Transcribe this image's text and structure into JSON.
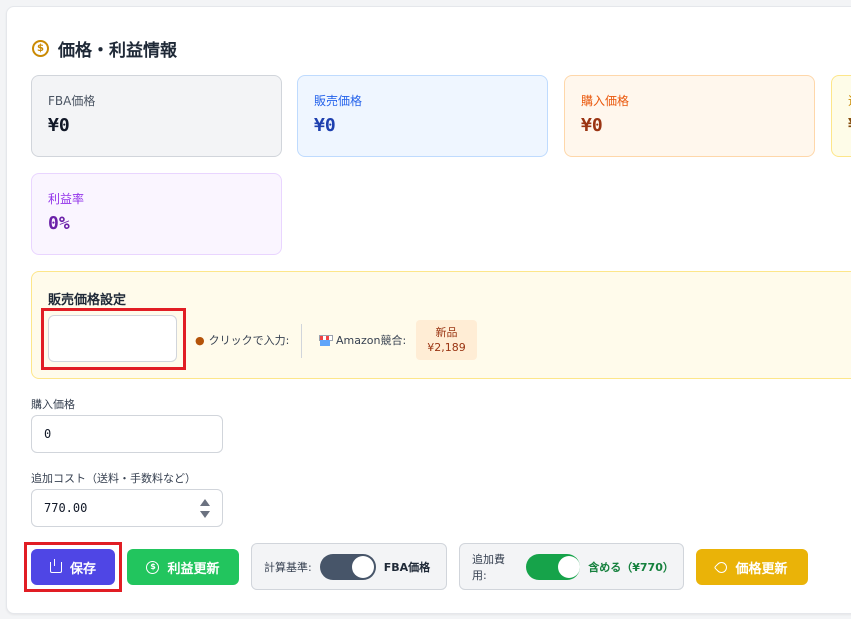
{
  "header": {
    "title": "価格・利益情報",
    "icon": "dollar-circle-icon"
  },
  "cards": {
    "fba": {
      "label": "FBA価格",
      "value": "¥0"
    },
    "sell": {
      "label": "販売価格",
      "value": "¥0"
    },
    "buy": {
      "label": "購入価格",
      "value": "¥0"
    },
    "extra": {
      "label": "追",
      "value": "¥"
    },
    "rate": {
      "label": "利益率",
      "value": "0%"
    }
  },
  "sell_setting": {
    "title": "販売価格設定",
    "input_value": "",
    "click_hint": "クリックで入力:",
    "amazon_label": "Amazon競合:",
    "badge_condition": "新品",
    "badge_price": "¥2,189"
  },
  "fields": {
    "purchase_label": "購入価格",
    "purchase_value": "0",
    "extra_cost_label": "追加コスト（送料・手数料など）",
    "extra_cost_value": "770.00"
  },
  "actions": {
    "save": "保存",
    "profit_update": "利益更新",
    "basis_label": "計算基準:",
    "basis_value": "FBA価格",
    "extra_label": "追加費用:",
    "extra_value": "含める（¥770）",
    "price_update": "価格更新"
  },
  "colors": {
    "save": "#4f46e5",
    "profit": "#22c55e",
    "price": "#eab308",
    "highlight": "#e11d24"
  }
}
